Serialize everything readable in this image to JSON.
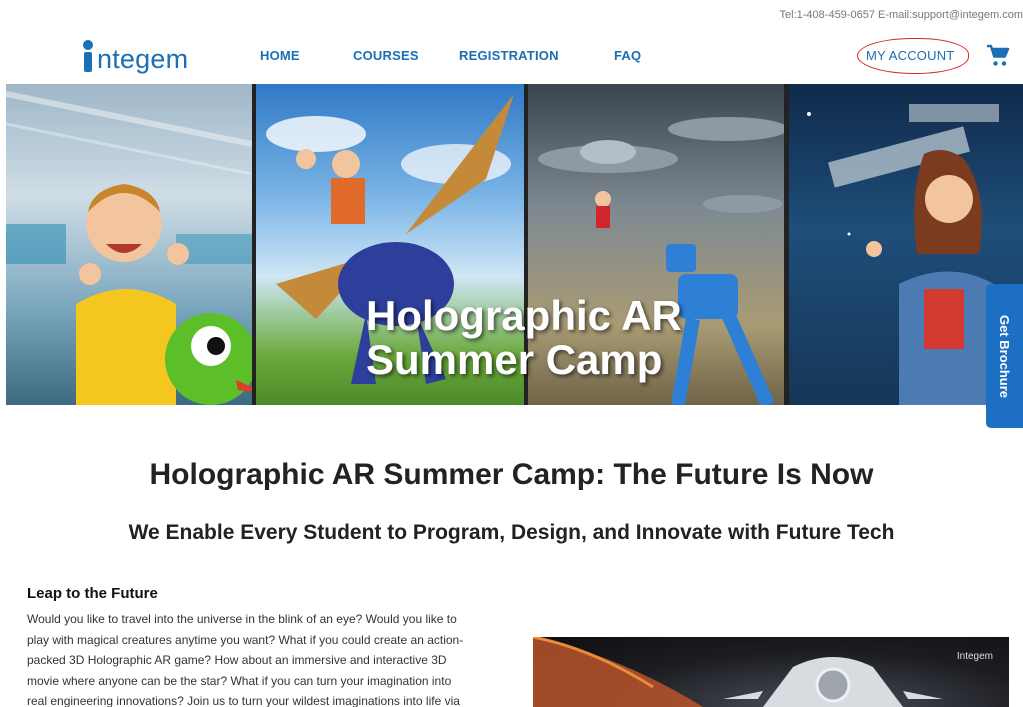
{
  "topbar": {
    "tel": "Tel:1-408-459-0657",
    "email": "E-mail:support@integem.com"
  },
  "logo": {
    "text": "ntegem"
  },
  "nav": {
    "home": "HOME",
    "courses": "COURSES",
    "registration": "REGISTRATION",
    "faq": "FAQ",
    "account": "MY ACCOUNT"
  },
  "banner": {
    "title_line1": "Holographic AR",
    "title_line2": "Summer Camp"
  },
  "brochure": {
    "label": "Get Brochure"
  },
  "headline": "Holographic AR Summer Camp: The Future Is Now",
  "subheadline": "We Enable Every Student to Program, Design, and Innovate with Future Tech",
  "leap": {
    "title": "Leap to the Future",
    "line1": "Would you like to travel into the universe in the blink of an eye? Would you like to",
    "line2": "play with magical creatures anytime you want? What if you could create an action-",
    "line3": "packed 3D Holographic AR game? How about an immersive and interactive 3D",
    "line4": "movie where anyone can be the star? What if you can turn your imagination into",
    "line5": "real engineering innovations? Join us to turn your wildest imaginations into life via"
  },
  "promo": {
    "logo": "Integem"
  },
  "colors": {
    "brand": "#1a6fb5",
    "brochure": "#1d6fc4",
    "annotation": "#d0262b"
  },
  "icons": {
    "cart": "cart-icon",
    "logo": "integem-logo-icon"
  }
}
